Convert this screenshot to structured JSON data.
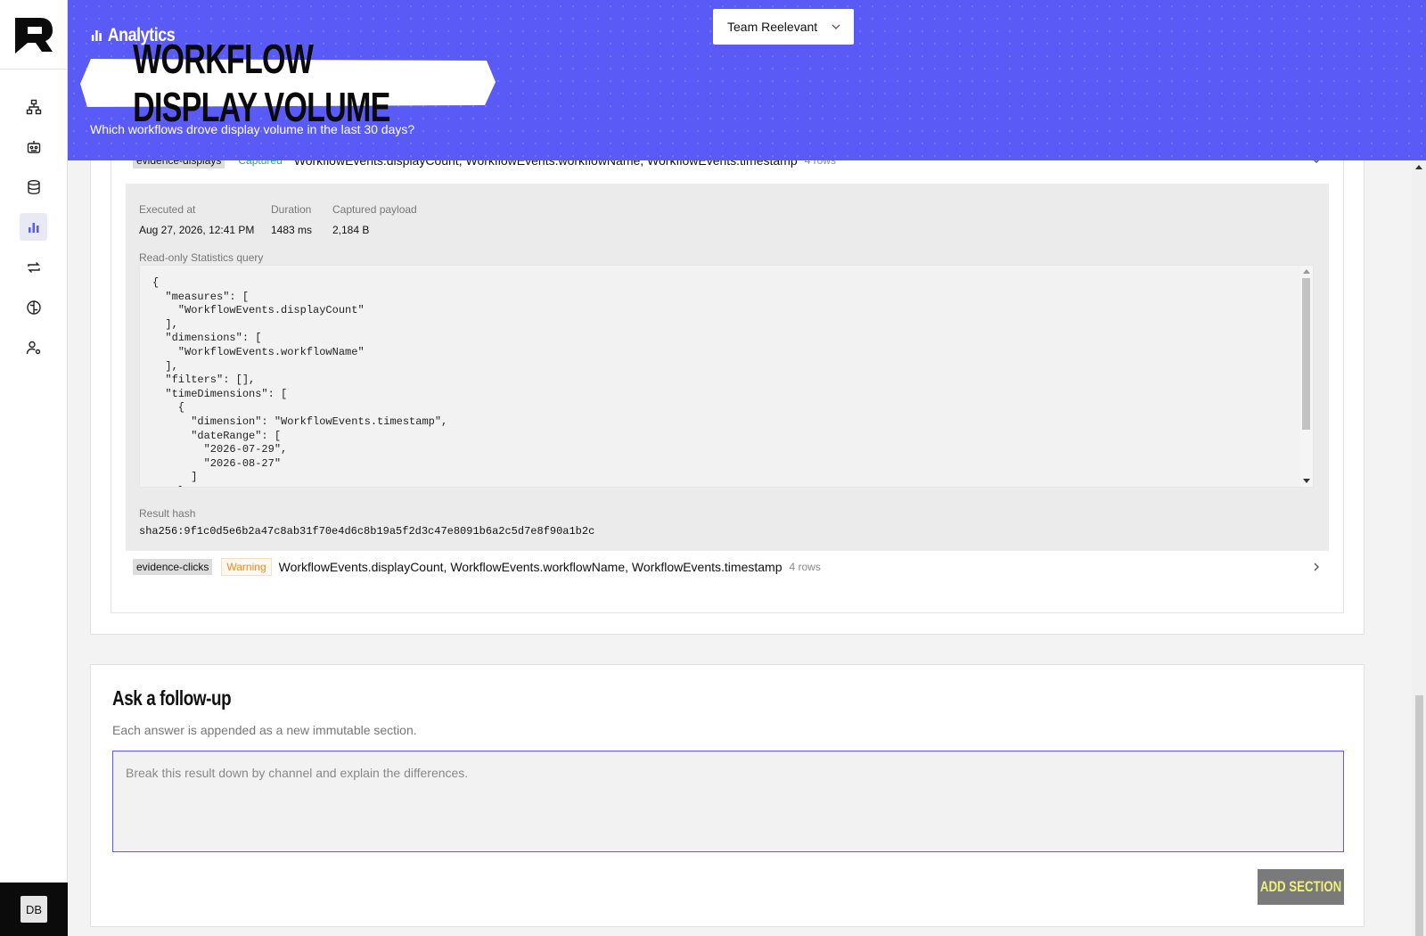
{
  "sidebar": {
    "items": [
      {
        "icon": "workflows-icon"
      },
      {
        "icon": "robot-icon"
      },
      {
        "icon": "database-icon"
      },
      {
        "icon": "analytics-icon",
        "active": true
      },
      {
        "icon": "sync-icon"
      },
      {
        "icon": "brain-icon"
      },
      {
        "icon": "user-settings-icon"
      }
    ],
    "user_initials": "DB"
  },
  "header": {
    "breadcrumb": "Analytics",
    "title": "WORKFLOW DISPLAY VOLUME",
    "subtitle": "Which workflows drove display volume in the last 30 days?",
    "team_select": "Team Reelevant",
    "accent": "#5a5af6"
  },
  "evidence": [
    {
      "tag": "evidence-displays",
      "status": "Captured",
      "fields": "WorkflowEvents.displayCount, WorkflowEvents.workflowName, WorkflowEvents.timestamp",
      "rows": "4 rows",
      "expanded": true,
      "executed_at_label": "Executed at",
      "executed_at": "Aug 27, 2026, 12:41 PM",
      "duration_label": "Duration",
      "duration": "1483 ms",
      "payload_label": "Captured payload",
      "payload": "2,184 B",
      "query_label": "Read-only Statistics query",
      "query": "{\n  \"measures\": [\n    \"WorkflowEvents.displayCount\"\n  ],\n  \"dimensions\": [\n    \"WorkflowEvents.workflowName\"\n  ],\n  \"filters\": [],\n  \"timeDimensions\": [\n    {\n      \"dimension\": \"WorkflowEvents.timestamp\",\n      \"dateRange\": [\n        \"2026-07-29\",\n        \"2026-08-27\"\n      ]\n    }\n  ]\n}",
      "hash_label": "Result hash",
      "hash": "sha256:9f1c0d5e6b2a47c8ab31f70e4d6c8b19a5f2d3c47e8091b6a2c5d7e8f90a1b2c"
    },
    {
      "tag": "evidence-clicks",
      "status": "Warning",
      "fields": "WorkflowEvents.displayCount, WorkflowEvents.workflowName, WorkflowEvents.timestamp",
      "rows": "4 rows",
      "expanded": false
    }
  ],
  "followup": {
    "title": "Ask a follow-up",
    "hint": "Each answer is appended as a new immutable section.",
    "placeholder": "Break this result down by channel and explain the differences.",
    "value": "",
    "button": "ADD SECTION",
    "button_color": "#eef07a"
  }
}
